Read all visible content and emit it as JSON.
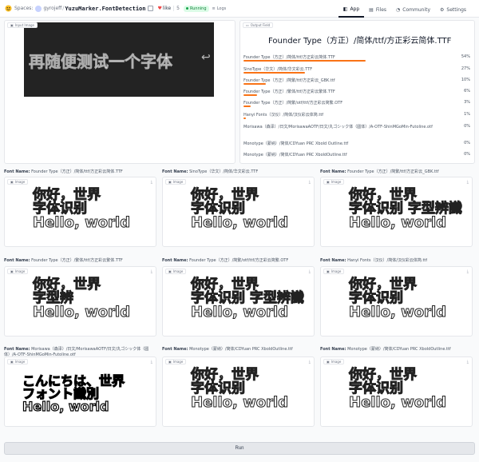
{
  "header": {
    "spaces": "Spaces:",
    "owner": "gyrojeff",
    "repo": "YuzuMarker.FontDetection",
    "like_label": "like",
    "like_count": "5",
    "status": "Running",
    "logs": "Logs",
    "nav": [
      {
        "label": "App",
        "icon": "app-icon"
      },
      {
        "label": "Files",
        "icon": "files-icon"
      },
      {
        "label": "Community",
        "icon": "community-icon"
      },
      {
        "label": "Settings",
        "icon": "settings-icon"
      }
    ]
  },
  "input_panel": {
    "label": "Input Image",
    "text": "再随便测试一个字体"
  },
  "output_panel": {
    "label": "Output Field",
    "title": "Founder Type（方正）/简体/ttf/方正彩云简体.TTF",
    "results": [
      {
        "name": "Founder Type（方正）/简体/ttf/方正彩云简体.TTF",
        "pct": "54%",
        "fraction": 0.54
      },
      {
        "name": "SinoType（华文）/简体/华文彩云.TTF",
        "pct": "27%",
        "fraction": 0.27
      },
      {
        "name": "Founder Type（方正）/简繁/ttf/方正彩云_GBK.ttf",
        "pct": "10%",
        "fraction": 0.1
      },
      {
        "name": "Founder Type（方正）/繁体/ttf/方正彩云繁体.TTF",
        "pct": "6%",
        "fraction": 0.06
      },
      {
        "name": "Founder Type（方正）/简繁/otf/ttf/方正彩云简繁.OTF",
        "pct": "3%",
        "fraction": 0.03
      },
      {
        "name": "Hanyi Fonts（汉仪）/简体/汉仪彩云体简.ttf",
        "pct": "1%",
        "fraction": 0.01
      },
      {
        "name": "Morisawa（森泽）/日文/MorisawaAOTF/日文/丸ゴシック体（圆体）/A-OTF-ShinMGoMin-Futoline.otf",
        "pct": "0%",
        "fraction": 0.0
      },
      {
        "name": "Monotype（蒙纳）/简体/CDYuan PRC Xbold Outline.ttf",
        "pct": "0%",
        "fraction": 0.0
      },
      {
        "name": "Monotype（蒙纳）/简体/CDYuan PRC XboldOutline.ttf",
        "pct": "0%",
        "fraction": 0.0
      }
    ]
  },
  "font_name_prefix": "Font Name:",
  "image_label": "Image",
  "cards": [
    {
      "font": "Founder Type（方正）/简体/ttf/方正彩云简体.TTF",
      "l1": "你好，世界",
      "l2": "字体识别",
      "l3": "Hello, world"
    },
    {
      "font": "SinoType（华文）/简体/华文彩云.TTF",
      "l1": "你好，世界",
      "l2": "字体识别",
      "l3": "Hello, world"
    },
    {
      "font": "Founder Type（方正）/简繁/ttf/方正彩云_GBK.ttf",
      "l1": "你好，世界",
      "l2": "字体识别 字型辨識",
      "l3": "Hello, world"
    },
    {
      "font": "Founder Type（方正）/繁体/ttf/方正彩云繁体.TTF",
      "l1": "你好，世界",
      "l2": "字型辨",
      "l3": "Hello, world"
    },
    {
      "font": "Founder Type（方正）/简繁/otf/ttf/方正彩云简繁.OTF",
      "l1": "你好，世界",
      "l2": "字体识别 字型辨識",
      "l3": "Hello, world"
    },
    {
      "font": "Hanyi Fonts（汉仪）/简体/汉仪彩云体简.ttf",
      "l1": "你好，世界",
      "l2": "字体识别",
      "l3": "Hello, world"
    },
    {
      "font": "Morisawa（森泽）/日文/MorisawaAOTF/日文/丸ゴシック体（圆体）/A-OTF-ShinMGoMin-Futoline.otf",
      "l1": "こんにちは、世界",
      "l2": "フォント識別",
      "l3": "Hello, world"
    },
    {
      "font": "Monotype（蒙纳）/简体/CDYuan PRC XboldOutline.ttf",
      "l1": "你好，世界",
      "l2": "字体识别",
      "l3": "Hello, world"
    },
    {
      "font": "Monotype（蒙纳）/简体/CDYuan PRC XboldOutline.ttf",
      "l1": "你好，世界",
      "l2": "字体识别",
      "l3": "Hello, world"
    }
  ],
  "run_label": "Run"
}
